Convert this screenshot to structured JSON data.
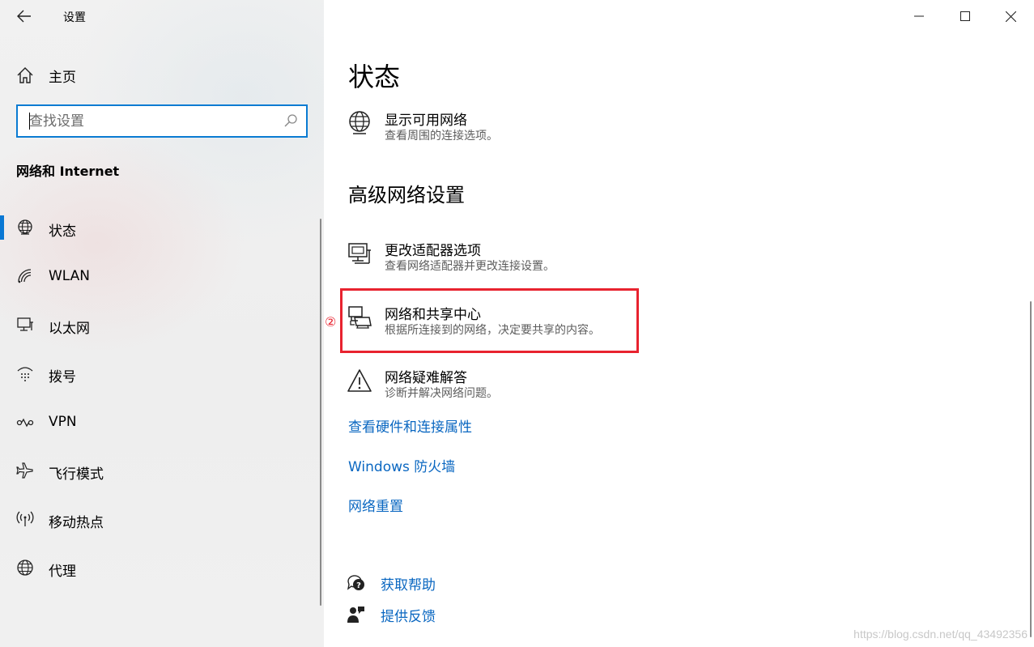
{
  "app": {
    "title": "设置"
  },
  "sidebar": {
    "home_label": "主页",
    "search_placeholder": "查找设置",
    "section_title": "网络和 Internet",
    "items": [
      {
        "label": "状态",
        "icon": "globe-status-icon",
        "selected": true
      },
      {
        "label": "WLAN",
        "icon": "wifi-icon"
      },
      {
        "label": "以太网",
        "icon": "ethernet-icon"
      },
      {
        "label": "拨号",
        "icon": "dialup-icon"
      },
      {
        "label": "VPN",
        "icon": "vpn-icon"
      },
      {
        "label": "飞行模式",
        "icon": "airplane-icon"
      },
      {
        "label": "移动热点",
        "icon": "hotspot-icon"
      },
      {
        "label": "代理",
        "icon": "globe-icon"
      }
    ]
  },
  "main": {
    "page_title": "状态",
    "show_networks": {
      "title": "显示可用网络",
      "desc": "查看周围的连接选项。"
    },
    "advanced_title": "高级网络设置",
    "advanced_items": [
      {
        "title": "更改适配器选项",
        "desc": "查看网络适配器并更改连接设置。",
        "icon": "adapter-icon"
      },
      {
        "title": "网络和共享中心",
        "desc": "根据所连接到的网络，决定要共享的内容。",
        "icon": "sharing-center-icon"
      },
      {
        "title": "网络疑难解答",
        "desc": "诊断并解决网络问题。",
        "icon": "warning-icon"
      }
    ],
    "links": [
      "查看硬件和连接属性",
      "Windows 防火墙",
      "网络重置"
    ],
    "help": {
      "get_help": "获取帮助",
      "feedback": "提供反馈"
    },
    "annotation_number": "②"
  },
  "watermark": "https://blog.csdn.net/qq_43492356",
  "colors": {
    "accent": "#0a78d4",
    "link": "#0a67c1",
    "highlight": "#e8232f"
  }
}
